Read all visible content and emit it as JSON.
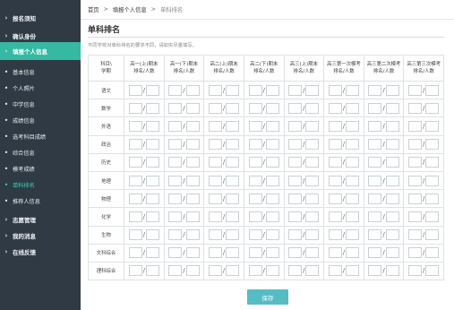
{
  "sidebar": {
    "top_items": [
      {
        "label": "报名须知"
      },
      {
        "label": "确认身份"
      },
      {
        "label": "填报个人信息"
      }
    ],
    "sub_items": [
      {
        "label": "基本信息"
      },
      {
        "label": "个人照片"
      },
      {
        "label": "中学信息"
      },
      {
        "label": "成绩信息"
      },
      {
        "label": "选考科目成绩"
      },
      {
        "label": "综合信息"
      },
      {
        "label": "模考成绩"
      },
      {
        "label": "单科排名"
      },
      {
        "label": "推荐人信息"
      }
    ],
    "bottom_items": [
      {
        "label": "志愿管理"
      },
      {
        "label": "我的消息"
      },
      {
        "label": "在线反馈"
      }
    ],
    "active_top": "填报个人信息",
    "active_sub": "单科排名"
  },
  "breadcrumb": {
    "home": "首页",
    "parent": "填报个人信息",
    "current": "单科排名",
    "separator": ">"
  },
  "page": {
    "title": "单科排名",
    "hint": "不同学校对单科排名的要求不同，请如实尽量填写。"
  },
  "table": {
    "corner_line1": "科目\\",
    "corner_line2": "学期",
    "columns": [
      {
        "line1": "高一(上)期末",
        "line2": "排名/人数"
      },
      {
        "line1": "高一(下)期末",
        "line2": "排名/人数"
      },
      {
        "line1": "高二(上)期末",
        "line2": "排名/人数"
      },
      {
        "line1": "高二(下)期末",
        "line2": "排名/人数"
      },
      {
        "line1": "高三(上)期末",
        "line2": "排名/人数"
      },
      {
        "line1": "高三第一次模考",
        "line2": "排名/人数"
      },
      {
        "line1": "高三第二次模考",
        "line2": "排名/人数"
      },
      {
        "line1": "高三第三次模考",
        "line2": "排名/人数"
      }
    ],
    "subjects": [
      "语文",
      "数学",
      "外语",
      "政治",
      "历史",
      "地理",
      "物理",
      "化学",
      "生物",
      "文科综合",
      "理科综合"
    ],
    "slash": "/"
  },
  "save_label": "保存",
  "colors": {
    "sidebar_bg": "#2f3a44",
    "active_green": "#35b9a2",
    "save_button": "#55bcc6"
  },
  "icons": {
    "nav_chevron": "chevron-right-icon",
    "sub_bullet": "bullet-dot-icon"
  }
}
